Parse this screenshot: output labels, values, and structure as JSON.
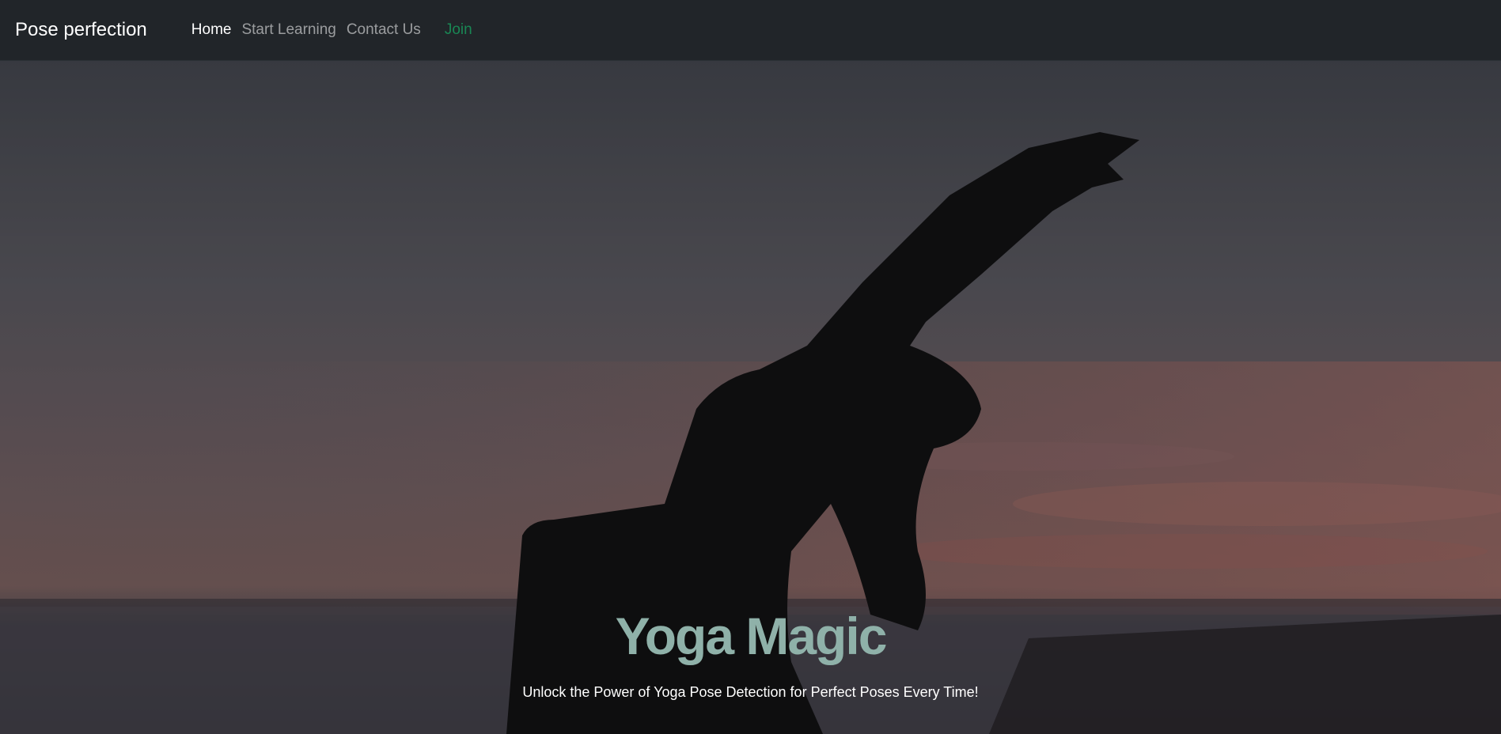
{
  "navbar": {
    "brand": "Pose perfection",
    "links": [
      {
        "label": "Home",
        "active": true
      },
      {
        "label": "Start Learning",
        "active": false
      },
      {
        "label": "Contact Us",
        "active": false
      }
    ],
    "join_label": "Join"
  },
  "hero": {
    "image": "yoga-silhouette-sunset-photo",
    "title": "Yoga Magic",
    "subtitle": "Unlock the Power of Yoga Pose Detection for Perfect Poses Every Time!"
  },
  "colors": {
    "navbar_bg": "#212529",
    "title": "#8fb1a9",
    "join": "#198754"
  }
}
